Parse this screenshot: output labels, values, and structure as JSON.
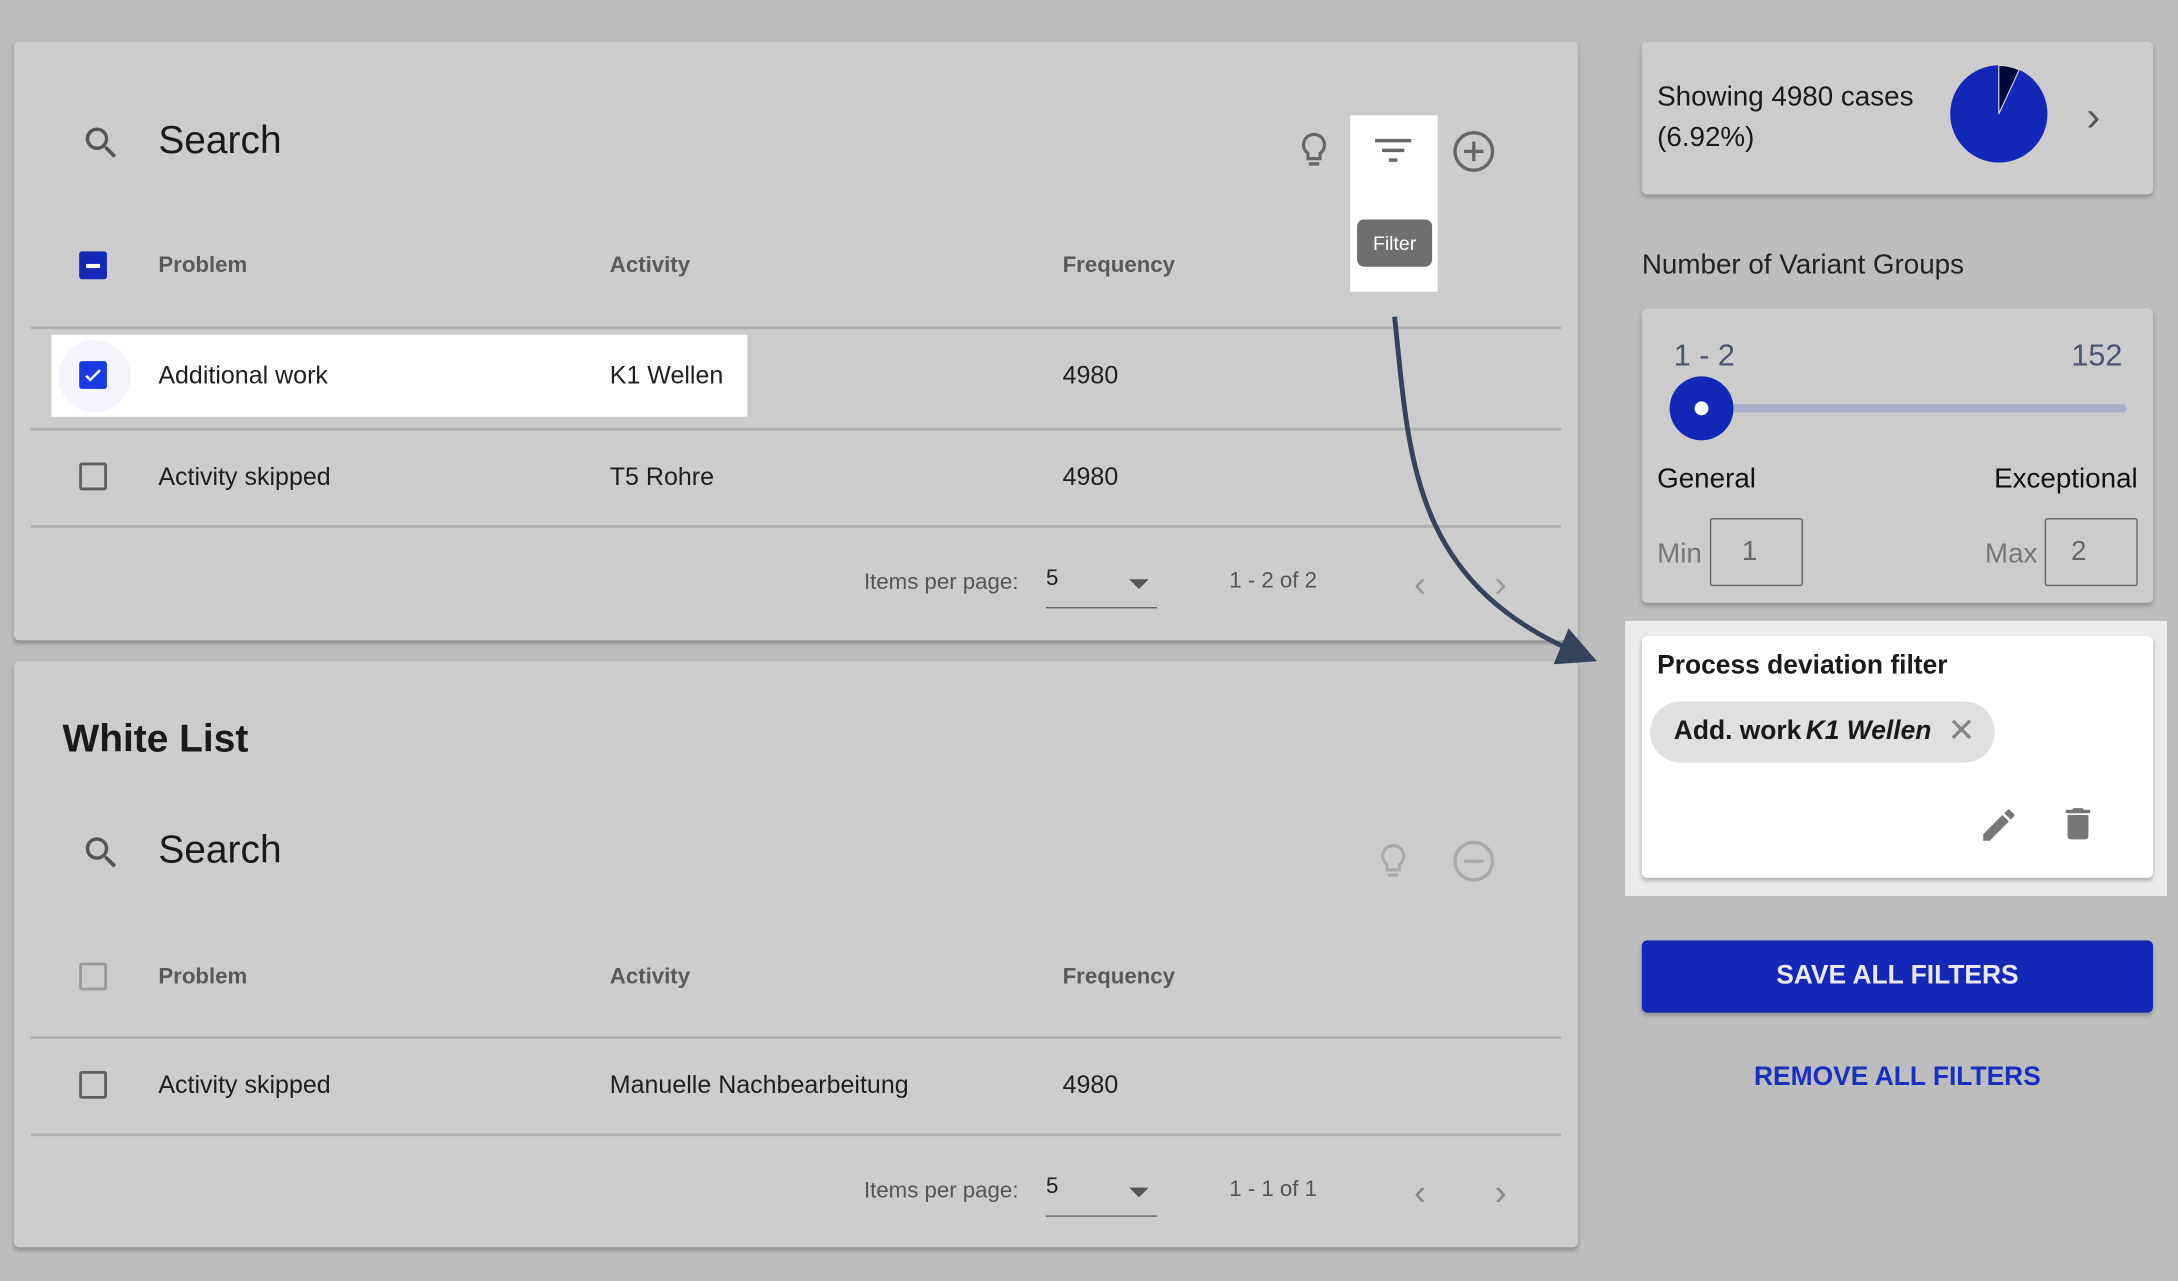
{
  "problems": {
    "search_placeholder": "Search",
    "tooltip": "Filter",
    "icons": [
      "search-icon",
      "lightbulb-icon",
      "filter-icon",
      "add-circle-icon"
    ],
    "columns": [
      "Problem",
      "Activity",
      "Frequency"
    ],
    "rows": [
      {
        "problem": "Additional work",
        "activity": "K1 Wellen",
        "frequency": "4980",
        "checked": true
      },
      {
        "problem": "Activity skipped",
        "activity": "T5 Rohre",
        "frequency": "4980",
        "checked": false
      }
    ],
    "paginator": {
      "items_label": "Items per page:",
      "page_size": "5",
      "range": "1 - 2 of 2"
    }
  },
  "whitelist": {
    "title": "White List",
    "search_placeholder": "Search",
    "icons": [
      "search-icon",
      "lightbulb-icon",
      "remove-circle-icon"
    ],
    "columns": [
      "Problem",
      "Activity",
      "Frequency"
    ],
    "rows": [
      {
        "problem": "Activity skipped",
        "activity": "Manuelle Nachbearbeitung",
        "frequency": "4980",
        "checked": false
      }
    ],
    "paginator": {
      "items_label": "Items per page:",
      "page_size": "5",
      "range": "1 - 1 of 1"
    }
  },
  "summary": {
    "line1": "Showing 4980 cases",
    "line2": "(6.92%)",
    "pie_fraction": 0.0692,
    "colors": {
      "main": "#1428b8",
      "slice": "#000a3a"
    }
  },
  "variants": {
    "title": "Number of Variant Groups",
    "range_label": "1 - 2",
    "max_label": "152",
    "slider_value": [
      1,
      2
    ],
    "slider_max": 152,
    "left_label": "General",
    "right_label": "Exceptional",
    "min_label": "Min",
    "min_value": "1",
    "max_field_label": "Max",
    "max_value": "2"
  },
  "deviation_filter": {
    "title": "Process deviation filter",
    "chip_prefix": "Add. work",
    "chip_activity": "K1 Wellen"
  },
  "actions": {
    "save": "SAVE ALL FILTERS",
    "remove": "REMOVE ALL FILTERS"
  },
  "colors": {
    "accent": "#1428b8",
    "background": "#bdbdbd",
    "card": "#cccccc"
  }
}
